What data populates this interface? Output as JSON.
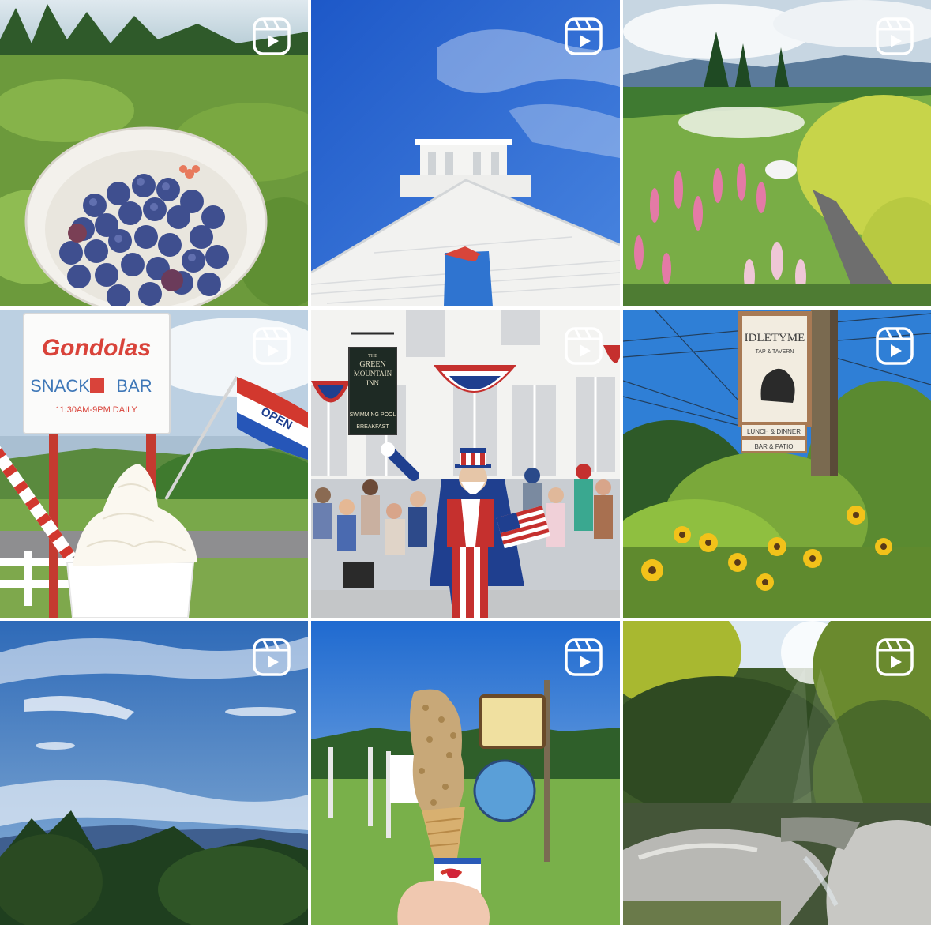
{
  "grid": {
    "reel_icon": "reels-play-icon",
    "posts": [
      {
        "subject": "blueberries-cup",
        "type": "reel"
      },
      {
        "subject": "white-building-steeple",
        "type": "reel"
      },
      {
        "subject": "flower-garden-path",
        "type": "reel"
      },
      {
        "subject": "snack-bar-soft-serve",
        "type": "reel",
        "sign_title": "Gondolas",
        "sign_line1": "SNACK",
        "sign_line1b": "BAR",
        "sign_hours": "11:30AM-9PM DAILY",
        "flag_text": "OPEN"
      },
      {
        "subject": "parade-uncle-sam",
        "type": "reel",
        "sign_small": "THE",
        "sign_line1": "GREEN",
        "sign_line2": "MOUNTAIN",
        "sign_line3": "INN",
        "sign_pool": "SWIMMING POOL",
        "sign_bottom": "BREAKFAST"
      },
      {
        "subject": "tavern-sign-sunflowers",
        "type": "reel",
        "sign_title": "IDLETYME",
        "sign_sub": "TAP & TAVERN",
        "plank1": "LUNCH & DINNER",
        "plank2": "BAR & PATIO"
      },
      {
        "subject": "mountain-sky",
        "type": "reel"
      },
      {
        "subject": "ice-cream-cone",
        "type": "reel"
      },
      {
        "subject": "forest-stream",
        "type": "reel"
      }
    ]
  }
}
